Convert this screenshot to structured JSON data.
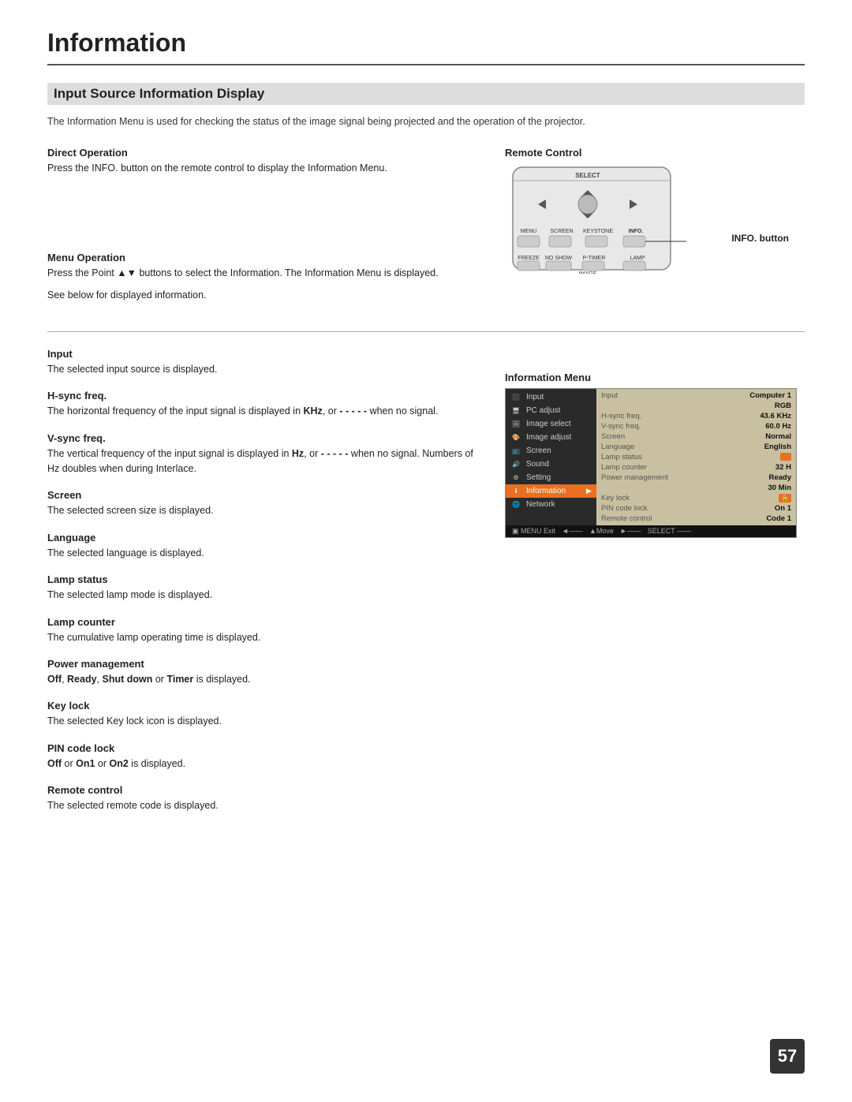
{
  "page": {
    "title": "Information",
    "number": "57",
    "section_heading": "Input Source Information Display",
    "intro": "The Information Menu is used for checking the status of the image signal being projected and the operation of the projector."
  },
  "direct_operation": {
    "title": "Direct Operation",
    "body": "Press the INFO. button on the remote control to display the Information Menu."
  },
  "remote_control": {
    "label": "Remote Control",
    "info_button_label": "INFO. button"
  },
  "menu_operation": {
    "title": "Menu Operation",
    "body1": "Press the Point ▲▼ buttons to select the Information. The Information Menu is displayed.",
    "body2": "See below for displayed information."
  },
  "information_menu": {
    "label": "Information Menu",
    "menu_items": [
      {
        "label": "Input",
        "icon": "input",
        "active": false
      },
      {
        "label": "PC adjust",
        "icon": "pc",
        "active": false
      },
      {
        "label": "Image select",
        "icon": "img-select",
        "active": false
      },
      {
        "label": "Image adjust",
        "icon": "img-adjust",
        "active": false
      },
      {
        "label": "Screen",
        "icon": "screen",
        "active": false
      },
      {
        "label": "Sound",
        "icon": "sound",
        "active": false
      },
      {
        "label": "Setting",
        "icon": "setting",
        "active": false
      },
      {
        "label": "Information",
        "icon": "info",
        "active": true
      },
      {
        "label": "Network",
        "icon": "network",
        "active": false
      }
    ],
    "info_rows": [
      {
        "label": "Input",
        "value": "Computer 1"
      },
      {
        "label": "",
        "value": "RGB"
      },
      {
        "label": "H-sync freq.",
        "value": "43.6   KHz"
      },
      {
        "label": "V-sync freq.",
        "value": "60.0   Hz"
      },
      {
        "label": "Screen",
        "value": "Normal"
      },
      {
        "label": "Language",
        "value": "English"
      },
      {
        "label": "Lamp status",
        "value": ""
      },
      {
        "label": "Lamp counter",
        "value": "32 H"
      },
      {
        "label": "Power management",
        "value": "Ready"
      },
      {
        "label": "",
        "value": "30 Min"
      },
      {
        "label": "Key lock",
        "value": "🔒"
      },
      {
        "label": "PIN code lock",
        "value": "On 1"
      },
      {
        "label": "Remote control",
        "value": "Code 1"
      }
    ],
    "bottom_bar": [
      "MENU Exit",
      "◄——",
      "▲Move",
      "►——",
      "SELECT ——"
    ]
  },
  "fields": [
    {
      "title": "Input",
      "body": "The selected input source is displayed."
    },
    {
      "title": "H-sync freq.",
      "body": "The horizontal frequency of the input signal is displayed in KHz, or - - - - - when no signal."
    },
    {
      "title": "V-sync freq.",
      "body": "The vertical frequency of the input signal is displayed in Hz, or - - - - - when no signal. Numbers of Hz doubles when during Interlace."
    },
    {
      "title": "Screen",
      "body": "The selected screen size is displayed."
    },
    {
      "title": "Language",
      "body": "The selected language is displayed."
    },
    {
      "title": "Lamp status",
      "body": "The selected lamp mode is displayed."
    },
    {
      "title": "Lamp counter",
      "body": "The cumulative lamp operating time is displayed."
    },
    {
      "title": "Power management",
      "body_parts": [
        "Off",
        ", ",
        "Ready",
        ", ",
        "Shut down",
        " or ",
        "Timer",
        " is displayed."
      ]
    },
    {
      "title": "Key lock",
      "body": "The selected Key lock icon is displayed."
    },
    {
      "title": "PIN code lock",
      "body_parts": [
        "Off",
        " or ",
        "On1",
        " or ",
        "On2",
        " is displayed."
      ]
    },
    {
      "title": "Remote control",
      "body": "The selected remote code  is displayed."
    }
  ]
}
